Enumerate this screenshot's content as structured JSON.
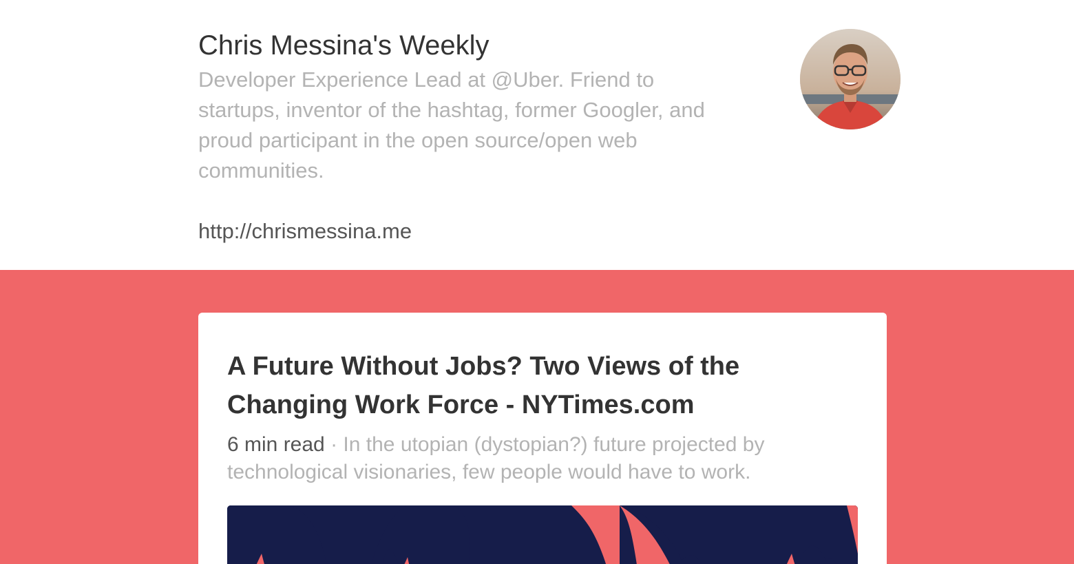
{
  "profile": {
    "title": "Chris Messina's Weekly",
    "bio": "Developer Experience Lead at @Uber. Friend to\nstartups, inventor of the hashtag, former Googler, and\nproud participant in the open source/open web\ncommunities.",
    "url": "http://chrismessina.me",
    "avatar_icon": "avatar-photo"
  },
  "colors": {
    "background_accent": "#f06668",
    "card": "#ffffff",
    "image_navy": "#161d4a"
  },
  "article": {
    "title": "A Future Without Jobs? Two Views of the Changing Work Force - NYTimes.com",
    "read_time": "6 min read",
    "separator": " · ",
    "excerpt": "In the utopian (dystopian?) future projected by technological visionaries, few people would have to work."
  }
}
